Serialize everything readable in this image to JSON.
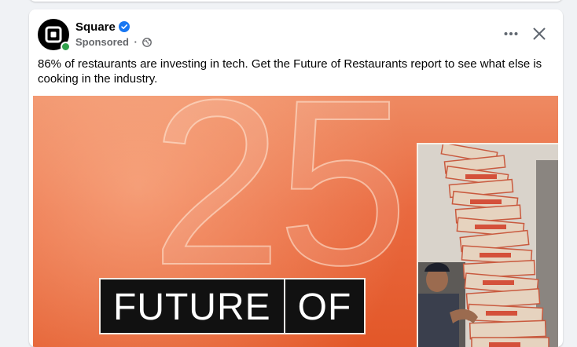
{
  "post": {
    "page_name": "Square",
    "sponsored_label": "Sponsored",
    "separator": "·",
    "text": "86% of restaurants are investing in tech. Get the Future of Restaurants report to see what else is cooking in the industry."
  },
  "ad_image": {
    "big_number": "25",
    "banner_words": [
      "FUTURE",
      "OF"
    ]
  },
  "icons": {
    "avatar": "square-logo-icon",
    "verified": "verified-badge-icon",
    "audience": "globe-icon",
    "more": "more-options-icon",
    "close": "close-icon"
  },
  "colors": {
    "page_background": "#f0f2f5",
    "card": "#ffffff",
    "verified_blue": "#1877f2",
    "online_green": "#31a24c",
    "ad_orange": "#e9693f"
  }
}
